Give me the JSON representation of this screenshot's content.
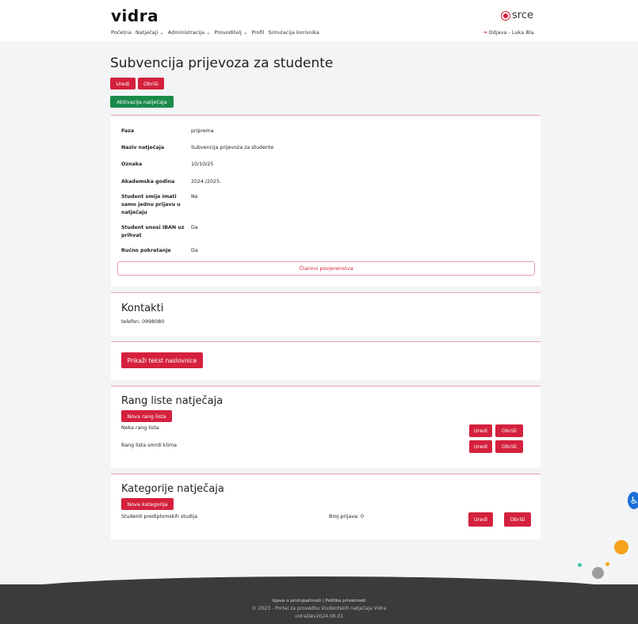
{
  "header": {
    "logo": "vidra",
    "nav": [
      "Početna",
      "Natječaji ⌄",
      "Administracija ⌄",
      "Provoditelj ⌄",
      "Profil",
      "Simulacija korisnika"
    ],
    "brand": "srce",
    "logout": "Odjava - Luka Bla"
  },
  "page": {
    "title": "Subvencija prijevoza za studente",
    "edit": "Uredi",
    "delete": "Obriši",
    "activate": "Aktivacija natječaja"
  },
  "details": {
    "rows": [
      {
        "k": "Faza",
        "v": "priprema"
      },
      {
        "k": "Naziv natječaja",
        "v": "Subvencija prijevoza za studente"
      },
      {
        "k": "Oznaka",
        "v": "10/10/25"
      },
      {
        "k": "Akademska godina",
        "v": "2024./2025."
      },
      {
        "k": "Student smije imati samo jednu prijavu u natječaju",
        "v": "Ne"
      },
      {
        "k": "Student unosi IBAN uz prihvat",
        "v": "Da"
      },
      {
        "k": "Ručno pokretanje",
        "v": "Da"
      }
    ],
    "committee": "Članovi povjerenstva"
  },
  "contacts": {
    "title": "Kontakti",
    "phone": "telefon: 0998080"
  },
  "cover": {
    "button": "Prikaži tekst naslovnice"
  },
  "ranks": {
    "title": "Rang liste natječaja",
    "new": "Nova rang lista",
    "items": [
      {
        "name": "Neka rang lista",
        "edit": "Uredi",
        "delete": "Obriši"
      },
      {
        "name": "Rang lista smrdi klima",
        "edit": "Uredi",
        "delete": "Obriši"
      }
    ]
  },
  "categories": {
    "title": "Kategorije natječaja",
    "new": "Nova kategorija",
    "items": [
      {
        "name": "Studenti prediplomskih studija",
        "count": "Broj prijava: 0",
        "edit": "Uredi",
        "delete": "Obriši"
      }
    ]
  },
  "footer": {
    "links": "Izjava o pristupačnosti   |   Politika privatnosti",
    "copyright": "© 2023 - Portal za provedbu studentskih natječaja Vidra",
    "version": "vidraDev2024.06.01"
  },
  "colors": {
    "primary": "#d4213d",
    "success": "#1a8a4a",
    "footer": "#3b3b3b"
  }
}
